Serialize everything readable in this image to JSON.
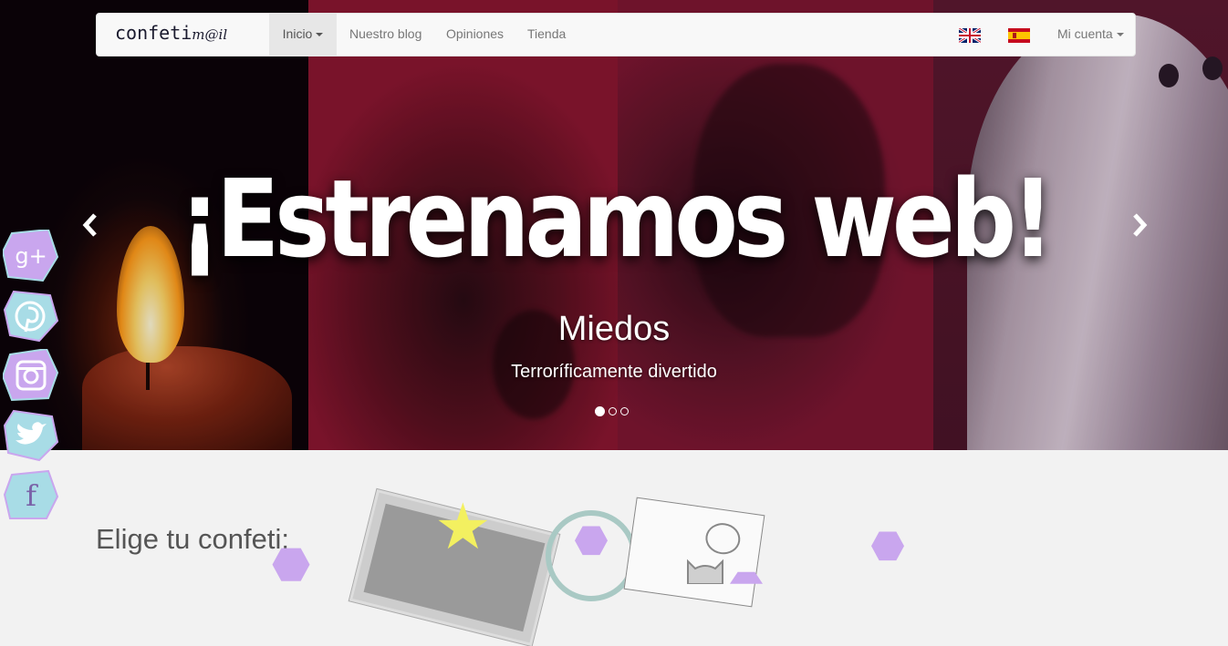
{
  "navbar": {
    "brand": {
      "part1": "confeti",
      "part2": "m@il"
    },
    "items": [
      {
        "label": "Inicio",
        "has_caret": true,
        "active": true
      },
      {
        "label": "Nuestro blog"
      },
      {
        "label": "Opiniones"
      },
      {
        "label": "Tienda"
      }
    ],
    "flags": [
      "flag-uk-icon",
      "flag-es-icon"
    ],
    "account": {
      "label": "Mi cuenta",
      "has_caret": true
    }
  },
  "hero": {
    "headline": "¡Estrenamos web!",
    "caption_title": "Miedos",
    "caption_subtitle": "Terroríficamente divertido",
    "slide_count": 3,
    "active_slide": 1,
    "prev_icon": "chevron-left-icon",
    "next_icon": "chevron-right-icon"
  },
  "social": [
    {
      "name": "google-plus",
      "icon": "google-plus-icon",
      "glyph": "g+",
      "color": "#c9a6ee"
    },
    {
      "name": "pinterest",
      "icon": "pinterest-icon",
      "glyph": "℗",
      "color": "#a8dce6"
    },
    {
      "name": "instagram",
      "icon": "instagram-icon",
      "glyph": "▣",
      "color": "#c9a6ee"
    },
    {
      "name": "twitter",
      "icon": "twitter-icon",
      "glyph": "❧",
      "color": "#a8dce6"
    },
    {
      "name": "facebook",
      "icon": "facebook-icon",
      "glyph": "f",
      "color": "#a8dce6"
    }
  ],
  "section": {
    "heading": "Elige tu confeti:"
  },
  "colors": {
    "navbar_bg": "#f8f8f8",
    "page_bg": "#f2f2f2",
    "accent_lilac": "#c9a6ee",
    "accent_aqua": "#a8dce6"
  }
}
